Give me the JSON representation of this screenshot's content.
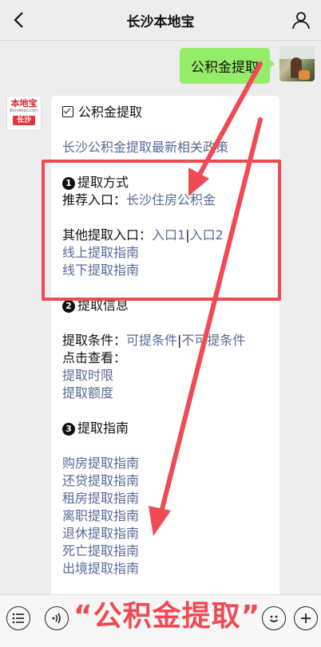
{
  "header": {
    "title": "长沙本地宝",
    "back_icon": "chevron-left-icon",
    "profile_icon": "person-icon"
  },
  "sent_message": {
    "text": "公积金提取"
  },
  "brand_avatar": {
    "logo": "本地宝",
    "site": "Bendibao.com",
    "city": "长沙"
  },
  "reply": {
    "topic": "公积金提取",
    "policy_link": "长沙公积金提取最新相关政策",
    "section1": {
      "num": "❶",
      "title": "提取方式",
      "recommend_label": "推荐入口：",
      "recommend_link": "长沙住房公积金",
      "other_label": "其他提取入口：",
      "entry1": "入口1",
      "divider": "|",
      "entry2": "入口2",
      "online_guide": "线上提取指南",
      "offline_guide": "线下提取指南"
    },
    "section2": {
      "num": "❷",
      "title": "提取信息",
      "cond_label": "提取条件：",
      "cond_yes": "可提条件",
      "divider": "|",
      "cond_no": "不可提条件",
      "click_label": "点击查看：",
      "time_limit": "提取时限",
      "amount": "提取额度"
    },
    "section3": {
      "num": "❸",
      "title": "提取指南",
      "guides": [
        "购房提取指南",
        "还贷提取指南",
        "租房提取指南",
        "离职提取指南",
        "退休提取指南",
        "死亡提取指南",
        "出境提取指南"
      ]
    }
  },
  "bottom_bar": {
    "caption": "“公积金提取”",
    "menu_icon": "menu-list-icon",
    "voice_icon": "voice-icon",
    "emoji_icon": "emoji-icon",
    "plus_icon": "plus-icon"
  },
  "colors": {
    "highlight": "#f04a55",
    "link": "#576b95",
    "green_bubble": "#95ec69"
  }
}
